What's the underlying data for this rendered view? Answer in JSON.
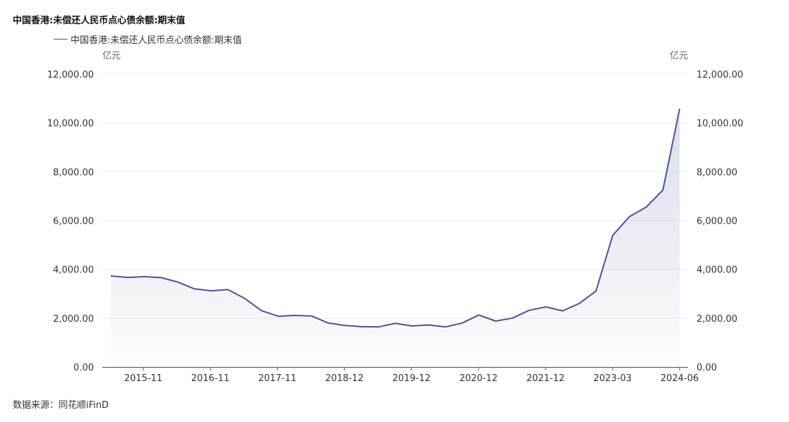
{
  "header": {
    "title": "中国香港:未偿还人民币点心债余额:期末值",
    "legend_label": "中国香港:未偿还人民币点心债余额:期末值"
  },
  "footer": {
    "source": "数据来源：同花顺iFinD"
  },
  "colors": {
    "line": "#4a5598",
    "fill": "#4a5598",
    "grid": "#ececec",
    "axis": "#333333"
  },
  "chart_data": {
    "type": "area",
    "title": "中国香港:未偿还人民币点心债余额:期末值",
    "y_unit_left": "亿元",
    "y_unit_right": "亿元",
    "ylim": [
      0,
      12000
    ],
    "y_ticks": [
      "0.00",
      "2,000.00",
      "4,000.00",
      "6,000.00",
      "8,000.00",
      "10,000.00",
      "12,000.00"
    ],
    "x_tick_labels": [
      "2015-11",
      "2016-11",
      "2017-11",
      "2018-12",
      "2019-12",
      "2020-12",
      "2021-12",
      "2023-03",
      "2024-06"
    ],
    "grid": true,
    "legend_position": "top-left",
    "series": [
      {
        "name": "中国香港:未偿还人民币点心债余额:期末值",
        "values": [
          3730,
          3670,
          3700,
          3660,
          3480,
          3200,
          3120,
          3170,
          2810,
          2310,
          2080,
          2110,
          2090,
          1800,
          1700,
          1650,
          1640,
          1790,
          1680,
          1720,
          1640,
          1800,
          2130,
          1880,
          2000,
          2320,
          2460,
          2300,
          2600,
          3110,
          5390,
          6160,
          6550,
          7250,
          10580
        ]
      }
    ]
  }
}
